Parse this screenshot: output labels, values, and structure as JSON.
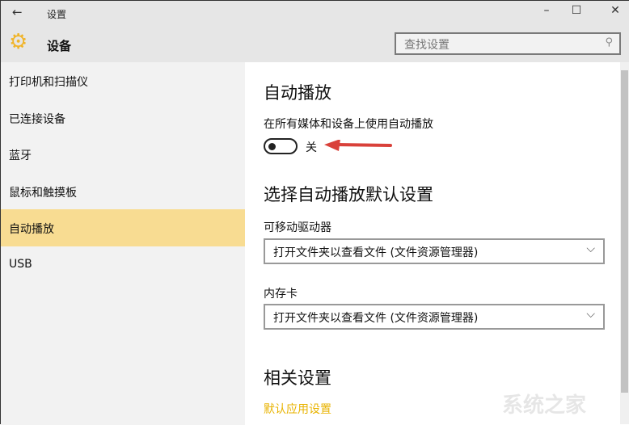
{
  "window": {
    "title": "设置",
    "back": "←",
    "minimize": "–",
    "maximize": "☐",
    "close": "✕"
  },
  "header": {
    "title": "设备",
    "search_placeholder": "查找设置",
    "search_icon": "⚲"
  },
  "sidebar": {
    "items": [
      {
        "label": "打印机和扫描仪"
      },
      {
        "label": "已连接设备"
      },
      {
        "label": "蓝牙"
      },
      {
        "label": "鼠标和触摸板"
      },
      {
        "label": "自动播放",
        "selected": true
      },
      {
        "label": "USB"
      }
    ]
  },
  "main": {
    "autoplay_title": "自动播放",
    "autoplay_toggle_label": "在所有媒体和设备上使用自动播放",
    "toggle_state": "关",
    "defaults_title": "选择自动播放默认设置",
    "removable_label": "可移动驱动器",
    "removable_value": "打开文件夹以查看文件 (文件资源管理器)",
    "memcard_label": "内存卡",
    "memcard_value": "打开文件夹以查看文件 (文件资源管理器)",
    "related_title": "相关设置",
    "default_apps_link": "默认应用设置"
  },
  "watermark": "系统之家",
  "colors": {
    "accent": "#f0b429",
    "selected": "#f8dc92",
    "arrow": "#d9413a"
  }
}
